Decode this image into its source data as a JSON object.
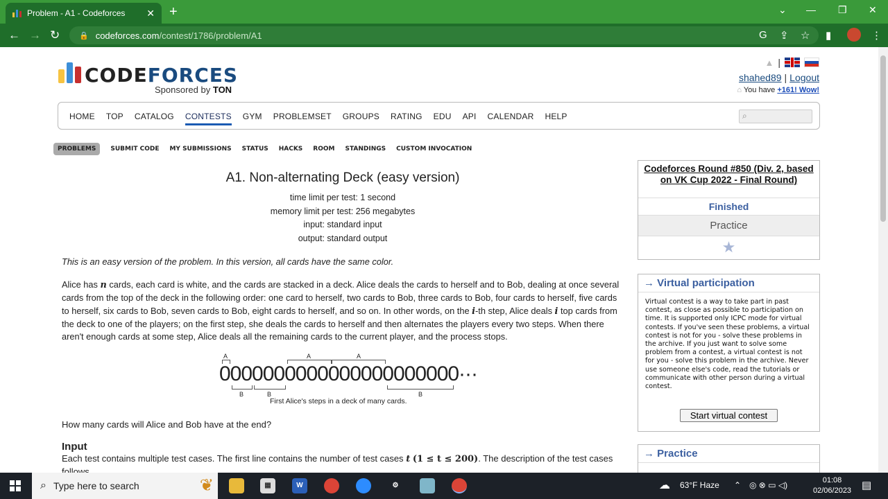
{
  "browser": {
    "tab_title": "Problem - A1 - Codeforces",
    "tab_close": "✕",
    "new_tab": "+",
    "url_host": "codeforces.com",
    "url_path": "/contest/1786/problem/A1",
    "controls": {
      "minimize": "⌄",
      "restore": "—",
      "maximize": "❐",
      "close": "✕"
    }
  },
  "logo": {
    "text_code": "CODE",
    "text_forces": "FORCES",
    "sponsored": "Sponsored by",
    "sponsor": "TON",
    "bar_colors": [
      "#f6c342",
      "#3d8fd8",
      "#c62f2f"
    ]
  },
  "user": {
    "name": "shahed89",
    "logout": "Logout",
    "rating_prefix": "You have",
    "rating_link": "+161! Wow!"
  },
  "main_menu": {
    "items": [
      "HOME",
      "TOP",
      "CATALOG",
      "CONTESTS",
      "GYM",
      "PROBLEMSET",
      "GROUPS",
      "RATING",
      "EDU",
      "API",
      "CALENDAR",
      "HELP"
    ],
    "active": "CONTESTS"
  },
  "sub_menu": {
    "items": [
      "PROBLEMS",
      "SUBMIT CODE",
      "MY SUBMISSIONS",
      "STATUS",
      "HACKS",
      "ROOM",
      "STANDINGS",
      "CUSTOM INVOCATION"
    ],
    "active": "PROBLEMS"
  },
  "problem": {
    "title": "A1. Non-alternating Deck (easy version)",
    "time_limit": "time limit per test: 1 second",
    "memory_limit": "memory limit per test: 256 megabytes",
    "input": "input: standard input",
    "output": "output: standard output",
    "note": "This is an easy version of the problem. In this version, all cards have the same color.",
    "statement_1": "Alice has",
    "var_n": "n",
    "statement_2": "cards, each card is white, and the cards are stacked in a deck. Alice deals the cards to herself and to Bob, dealing at once several cards from the top of the deck in the following order: one card to herself, two cards to Bob, three cards to Bob, four cards to herself, five cards to herself, six cards to Bob, seven cards to Bob, eight cards to herself, and so on. In other words, on the",
    "var_i": "i",
    "statement_3": "-th step, Alice deals",
    "statement_4": "top cards from the deck to one of the players; on the first step, she deals the cards to herself and then alternates the players every two steps. When there aren't enough cards at some step, Alice deals all the remaining cards to the current player, and the process stops.",
    "figure_zeros": "0000000000000000000000···",
    "figure_labels_top": [
      "A",
      "A",
      "A"
    ],
    "figure_labels_bottom": [
      "B",
      "B",
      "B"
    ],
    "figure_caption": "First Alice's steps in a deck of many cards.",
    "question": "How many cards will Alice and Bob have at the end?",
    "input_title": "Input",
    "input_text_1": "Each test contains multiple test cases. The first line contains the number of test cases",
    "input_var": "t",
    "input_constraint": "(1 ≤ t ≤ 200)",
    "input_text_2": ". The description of the test cases follows"
  },
  "sidebar": {
    "round_title": "Codeforces Round #850 (Div. 2, based on VK Cup 2022 - Final Round)",
    "round_status": "Finished",
    "round_practice": "Practice",
    "star": "★",
    "virtual_title": "→ Virtual participation",
    "virtual_text": "Virtual contest is a way to take part in past contest, as close as possible to participation on time. It is supported only ICPC mode for virtual contests. If you've seen these problems, a virtual contest is not for you - solve these problems in the archive. If you just want to solve some problem from a contest, a virtual contest is not for you - solve this problem in the archive. Never use someone else's code, read the tutorials or communicate with other person during a virtual contest.",
    "virtual_button": "Start virtual contest",
    "practice_title": "→ Practice"
  },
  "taskbar": {
    "search_placeholder": "Type here to search",
    "weather": "63°F  Haze",
    "time": "01:08",
    "date": "02/06/2023"
  }
}
